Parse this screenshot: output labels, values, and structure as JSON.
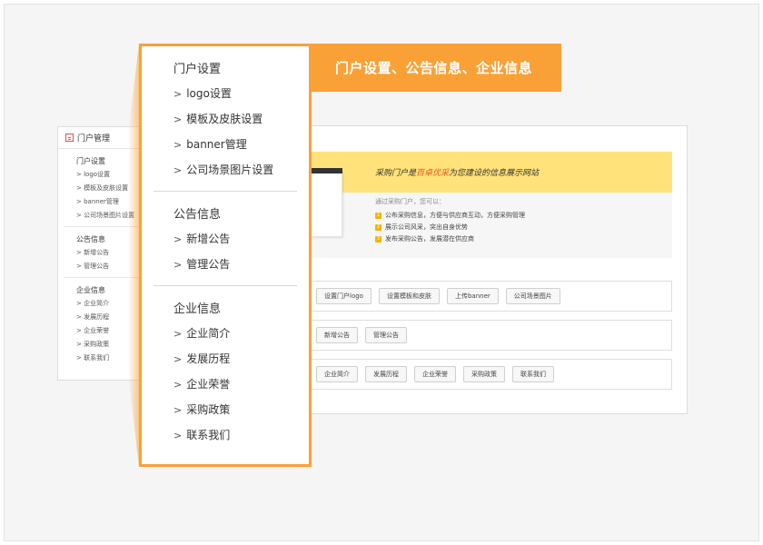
{
  "mini_nav": {
    "title": "门户管理",
    "groups": [
      {
        "title": "门户设置",
        "items": [
          "logo设置",
          "模板及皮肤设置",
          "banner管理",
          "公司场景图片设置"
        ]
      },
      {
        "title": "公告信息",
        "items": [
          "新增公告",
          "管理公告"
        ]
      },
      {
        "title": "企业信息",
        "items": [
          "企业简介",
          "发展历程",
          "企业荣誉",
          "采购政策",
          "联系我们"
        ]
      }
    ]
  },
  "banner": {
    "slogan_pre": "采购门户是",
    "slogan_highlight": "百卓优采",
    "slogan_post": "为您建设的信息展示网站",
    "intro": "通过采购门户，您可以：",
    "points": [
      {
        "num": "1",
        "text": "公布采购信息，方便与供应商互动，方便采购管理"
      },
      {
        "num": "2",
        "text": "展示公司风采，突出自身优势"
      },
      {
        "num": "3",
        "text": "发布采购公告，发展潜在供应商"
      }
    ]
  },
  "rows": [
    [
      "设置门户logo",
      "设置模板和皮肤",
      "上传banner",
      "公司场景图片"
    ],
    [
      "新增公告",
      "管理公告"
    ],
    [
      "企业简介",
      "发展历程",
      "企业荣誉",
      "采购政策",
      "联系我们"
    ]
  ],
  "tag": {
    "text": "门户设置、公告信息、企业信息"
  },
  "zoom_menu": {
    "groups": [
      {
        "title": "门户设置",
        "items": [
          "logo设置",
          "模板及皮肤设置",
          "banner管理",
          "公司场景图片设置"
        ]
      },
      {
        "title": "公告信息",
        "items": [
          "新增公告",
          "管理公告"
        ]
      },
      {
        "title": "企业信息",
        "items": [
          "企业简介",
          "发展历程",
          "企业荣誉",
          "采购政策",
          "联系我们"
        ]
      }
    ],
    "arrow": ">"
  },
  "colors": {
    "accent": "#f9a136",
    "banner_yellow": "#ffe37a",
    "highlight": "#e8541e"
  }
}
